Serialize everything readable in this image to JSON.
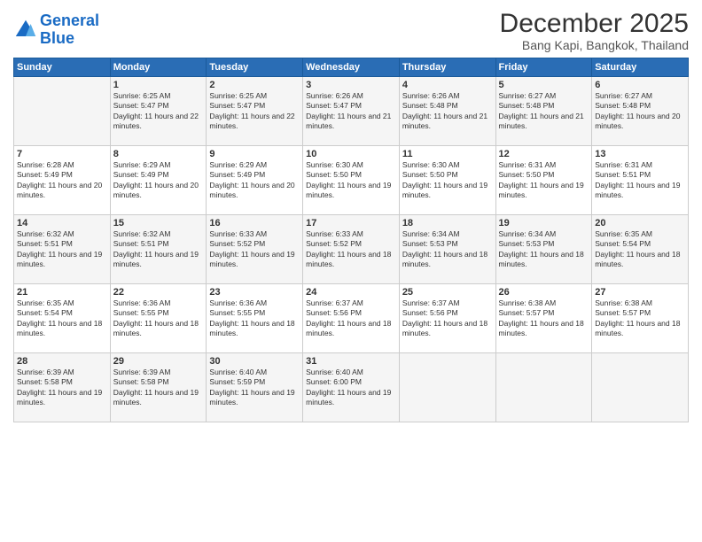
{
  "header": {
    "logo_line1": "General",
    "logo_line2": "Blue",
    "title": "December 2025",
    "subtitle": "Bang Kapi, Bangkok, Thailand"
  },
  "days_of_week": [
    "Sunday",
    "Monday",
    "Tuesday",
    "Wednesday",
    "Thursday",
    "Friday",
    "Saturday"
  ],
  "weeks": [
    [
      {
        "day": "",
        "sunrise": "",
        "sunset": "",
        "daylight": ""
      },
      {
        "day": "1",
        "sunrise": "Sunrise: 6:25 AM",
        "sunset": "Sunset: 5:47 PM",
        "daylight": "Daylight: 11 hours and 22 minutes."
      },
      {
        "day": "2",
        "sunrise": "Sunrise: 6:25 AM",
        "sunset": "Sunset: 5:47 PM",
        "daylight": "Daylight: 11 hours and 22 minutes."
      },
      {
        "day": "3",
        "sunrise": "Sunrise: 6:26 AM",
        "sunset": "Sunset: 5:47 PM",
        "daylight": "Daylight: 11 hours and 21 minutes."
      },
      {
        "day": "4",
        "sunrise": "Sunrise: 6:26 AM",
        "sunset": "Sunset: 5:48 PM",
        "daylight": "Daylight: 11 hours and 21 minutes."
      },
      {
        "day": "5",
        "sunrise": "Sunrise: 6:27 AM",
        "sunset": "Sunset: 5:48 PM",
        "daylight": "Daylight: 11 hours and 21 minutes."
      },
      {
        "day": "6",
        "sunrise": "Sunrise: 6:27 AM",
        "sunset": "Sunset: 5:48 PM",
        "daylight": "Daylight: 11 hours and 20 minutes."
      }
    ],
    [
      {
        "day": "7",
        "sunrise": "Sunrise: 6:28 AM",
        "sunset": "Sunset: 5:49 PM",
        "daylight": "Daylight: 11 hours and 20 minutes."
      },
      {
        "day": "8",
        "sunrise": "Sunrise: 6:29 AM",
        "sunset": "Sunset: 5:49 PM",
        "daylight": "Daylight: 11 hours and 20 minutes."
      },
      {
        "day": "9",
        "sunrise": "Sunrise: 6:29 AM",
        "sunset": "Sunset: 5:49 PM",
        "daylight": "Daylight: 11 hours and 20 minutes."
      },
      {
        "day": "10",
        "sunrise": "Sunrise: 6:30 AM",
        "sunset": "Sunset: 5:50 PM",
        "daylight": "Daylight: 11 hours and 19 minutes."
      },
      {
        "day": "11",
        "sunrise": "Sunrise: 6:30 AM",
        "sunset": "Sunset: 5:50 PM",
        "daylight": "Daylight: 11 hours and 19 minutes."
      },
      {
        "day": "12",
        "sunrise": "Sunrise: 6:31 AM",
        "sunset": "Sunset: 5:50 PM",
        "daylight": "Daylight: 11 hours and 19 minutes."
      },
      {
        "day": "13",
        "sunrise": "Sunrise: 6:31 AM",
        "sunset": "Sunset: 5:51 PM",
        "daylight": "Daylight: 11 hours and 19 minutes."
      }
    ],
    [
      {
        "day": "14",
        "sunrise": "Sunrise: 6:32 AM",
        "sunset": "Sunset: 5:51 PM",
        "daylight": "Daylight: 11 hours and 19 minutes."
      },
      {
        "day": "15",
        "sunrise": "Sunrise: 6:32 AM",
        "sunset": "Sunset: 5:51 PM",
        "daylight": "Daylight: 11 hours and 19 minutes."
      },
      {
        "day": "16",
        "sunrise": "Sunrise: 6:33 AM",
        "sunset": "Sunset: 5:52 PM",
        "daylight": "Daylight: 11 hours and 19 minutes."
      },
      {
        "day": "17",
        "sunrise": "Sunrise: 6:33 AM",
        "sunset": "Sunset: 5:52 PM",
        "daylight": "Daylight: 11 hours and 18 minutes."
      },
      {
        "day": "18",
        "sunrise": "Sunrise: 6:34 AM",
        "sunset": "Sunset: 5:53 PM",
        "daylight": "Daylight: 11 hours and 18 minutes."
      },
      {
        "day": "19",
        "sunrise": "Sunrise: 6:34 AM",
        "sunset": "Sunset: 5:53 PM",
        "daylight": "Daylight: 11 hours and 18 minutes."
      },
      {
        "day": "20",
        "sunrise": "Sunrise: 6:35 AM",
        "sunset": "Sunset: 5:54 PM",
        "daylight": "Daylight: 11 hours and 18 minutes."
      }
    ],
    [
      {
        "day": "21",
        "sunrise": "Sunrise: 6:35 AM",
        "sunset": "Sunset: 5:54 PM",
        "daylight": "Daylight: 11 hours and 18 minutes."
      },
      {
        "day": "22",
        "sunrise": "Sunrise: 6:36 AM",
        "sunset": "Sunset: 5:55 PM",
        "daylight": "Daylight: 11 hours and 18 minutes."
      },
      {
        "day": "23",
        "sunrise": "Sunrise: 6:36 AM",
        "sunset": "Sunset: 5:55 PM",
        "daylight": "Daylight: 11 hours and 18 minutes."
      },
      {
        "day": "24",
        "sunrise": "Sunrise: 6:37 AM",
        "sunset": "Sunset: 5:56 PM",
        "daylight": "Daylight: 11 hours and 18 minutes."
      },
      {
        "day": "25",
        "sunrise": "Sunrise: 6:37 AM",
        "sunset": "Sunset: 5:56 PM",
        "daylight": "Daylight: 11 hours and 18 minutes."
      },
      {
        "day": "26",
        "sunrise": "Sunrise: 6:38 AM",
        "sunset": "Sunset: 5:57 PM",
        "daylight": "Daylight: 11 hours and 18 minutes."
      },
      {
        "day": "27",
        "sunrise": "Sunrise: 6:38 AM",
        "sunset": "Sunset: 5:57 PM",
        "daylight": "Daylight: 11 hours and 18 minutes."
      }
    ],
    [
      {
        "day": "28",
        "sunrise": "Sunrise: 6:39 AM",
        "sunset": "Sunset: 5:58 PM",
        "daylight": "Daylight: 11 hours and 19 minutes."
      },
      {
        "day": "29",
        "sunrise": "Sunrise: 6:39 AM",
        "sunset": "Sunset: 5:58 PM",
        "daylight": "Daylight: 11 hours and 19 minutes."
      },
      {
        "day": "30",
        "sunrise": "Sunrise: 6:40 AM",
        "sunset": "Sunset: 5:59 PM",
        "daylight": "Daylight: 11 hours and 19 minutes."
      },
      {
        "day": "31",
        "sunrise": "Sunrise: 6:40 AM",
        "sunset": "Sunset: 6:00 PM",
        "daylight": "Daylight: 11 hours and 19 minutes."
      },
      {
        "day": "",
        "sunrise": "",
        "sunset": "",
        "daylight": ""
      },
      {
        "day": "",
        "sunrise": "",
        "sunset": "",
        "daylight": ""
      },
      {
        "day": "",
        "sunrise": "",
        "sunset": "",
        "daylight": ""
      }
    ]
  ]
}
